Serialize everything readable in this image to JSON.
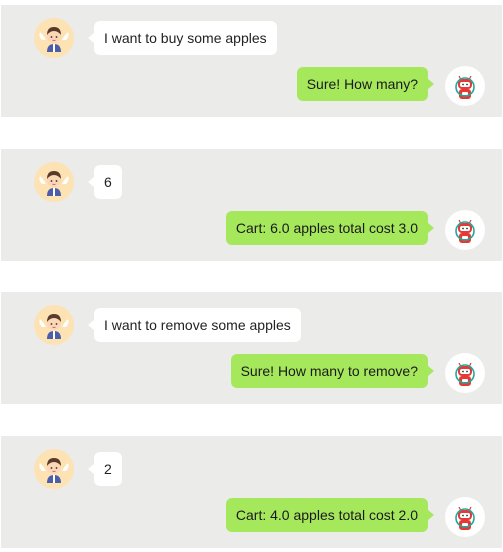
{
  "conversation": [
    {
      "user_text": "I want to buy some apples",
      "bot_text": "Sure! How many?"
    },
    {
      "user_text": "6",
      "bot_text": "Cart: 6.0 apples total cost 3.0"
    },
    {
      "user_text": "I want to remove some apples",
      "bot_text": "Sure! How many to remove?"
    },
    {
      "user_text": "2",
      "bot_text": "Cart: 4.0 apples total cost 2.0"
    }
  ],
  "colors": {
    "panel_bg": "#ebebea",
    "user_bubble": "#ffffff",
    "bot_bubble": "#a6e85c"
  },
  "icons": {
    "user_avatar": "boy-avatar-icon",
    "bot_avatar": "robot-avatar-icon"
  }
}
